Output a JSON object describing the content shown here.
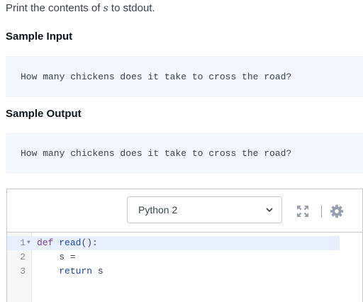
{
  "problem": {
    "intro_prefix": "Print the contents of ",
    "intro_var": "s",
    "intro_suffix": " to stdout."
  },
  "sample_input": {
    "title": "Sample Input",
    "text": "How many chickens does it take to cross the road?"
  },
  "sample_output": {
    "title": "Sample Output",
    "text": "How many chickens does it take to cross the road?"
  },
  "editor": {
    "language": "Python 2",
    "toolbar_icons": [
      "chevron-down-icon",
      "fullscreen-icon",
      "gear-icon"
    ],
    "colors": {
      "keyword": "#7a3e9d",
      "function": "#1a44b8",
      "active_line": "#e8f0fe"
    },
    "lines": [
      {
        "number": "1",
        "keyword": "def",
        "name": "read",
        "rest": "():"
      },
      {
        "number": "2",
        "text": "    s ="
      },
      {
        "number": "3",
        "keyword": "return",
        "rest": " s"
      }
    ]
  }
}
